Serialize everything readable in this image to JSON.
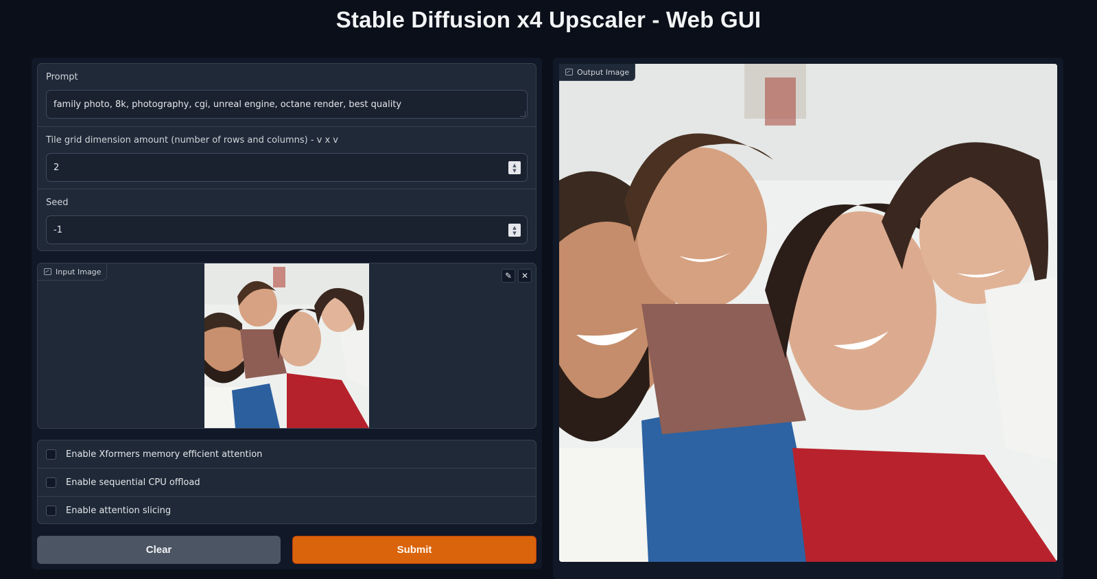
{
  "app": {
    "title": "Stable Diffusion x4 Upscaler - Web GUI"
  },
  "params": {
    "prompt_label": "Prompt",
    "prompt_value": "family photo, 8k, photography, cgi, unreal engine, octane render, best quality",
    "tile_label": "Tile grid dimension amount (number of rows and columns) - v x v",
    "tile_value": "2",
    "seed_label": "Seed",
    "seed_value": "-1"
  },
  "input_image": {
    "label": "Input Image",
    "edit_icon": "pencil-icon",
    "close_icon": "close-icon"
  },
  "options": [
    {
      "label": "Enable Xformers memory efficient attention",
      "checked": false
    },
    {
      "label": "Enable sequential CPU offload",
      "checked": false
    },
    {
      "label": "Enable attention slicing",
      "checked": false
    }
  ],
  "buttons": {
    "clear": "Clear",
    "submit": "Submit"
  },
  "output_image": {
    "label": "Output Image"
  },
  "colors": {
    "background": "#0b0f19",
    "panel": "#1f2937",
    "accent": "#d9640b"
  }
}
